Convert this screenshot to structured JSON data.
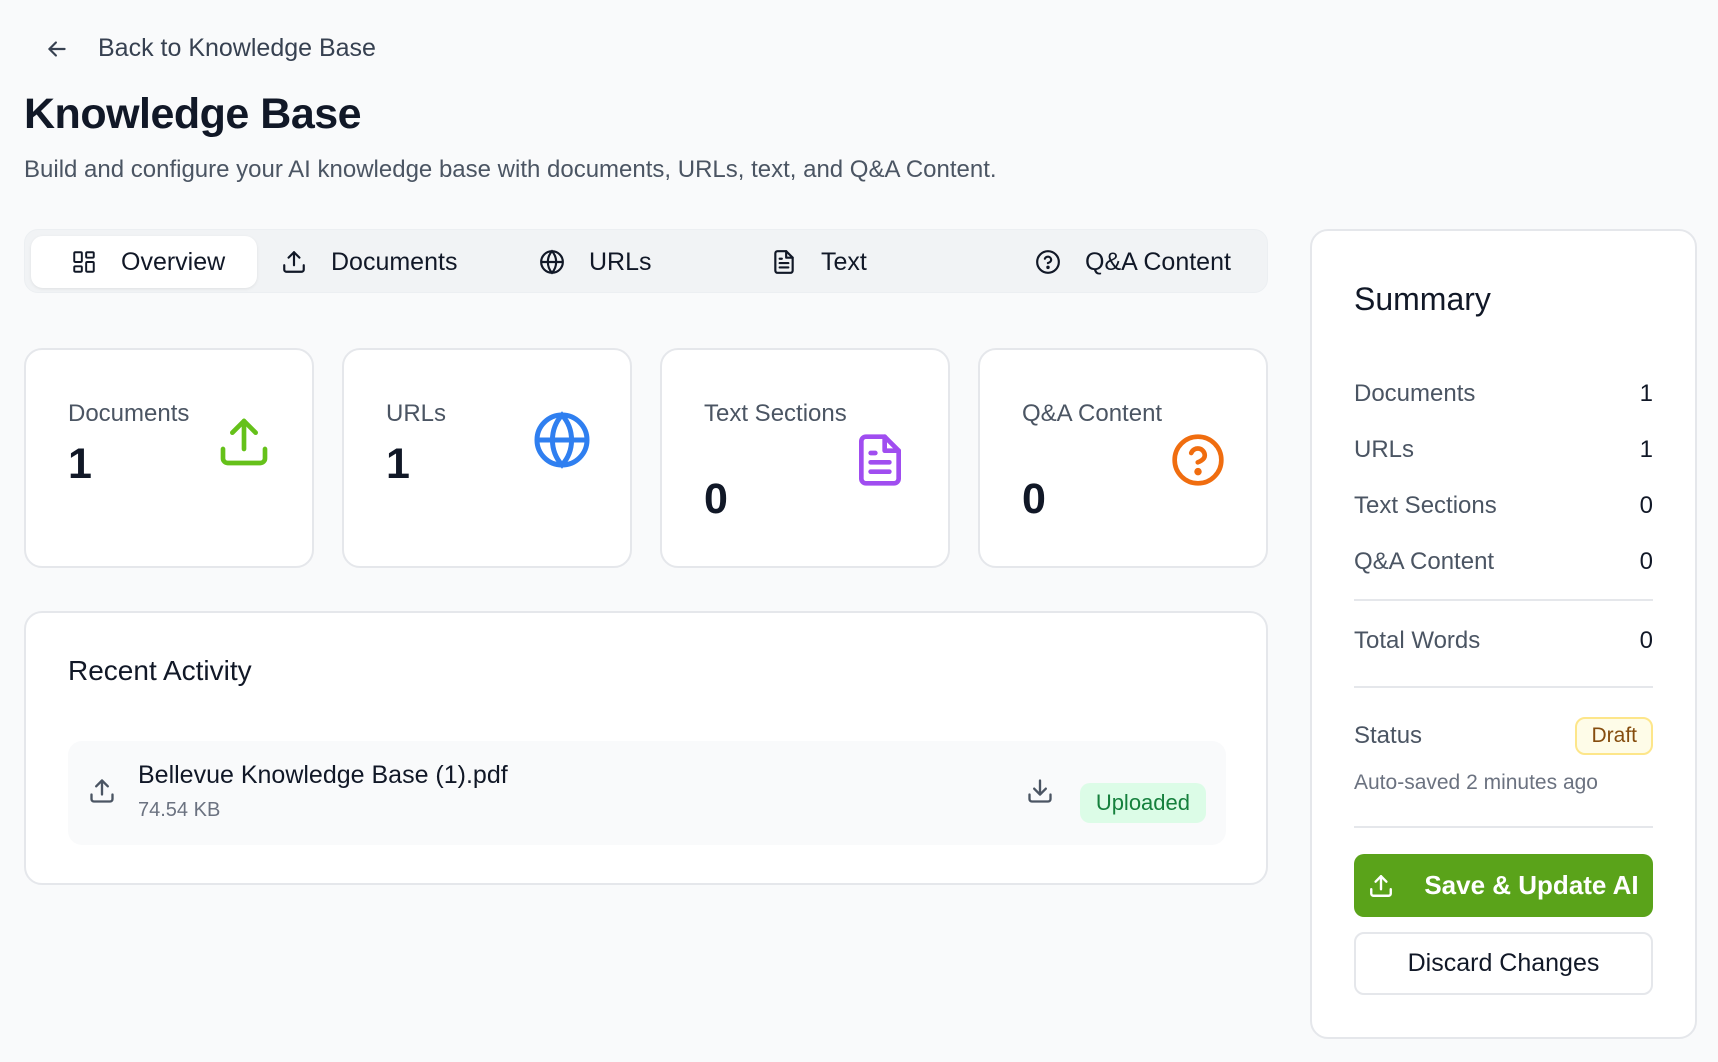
{
  "nav": {
    "back_label": "Back to Knowledge Base"
  },
  "header": {
    "title": "Knowledge Base",
    "subtitle": "Build and configure your AI knowledge base with documents, URLs, text, and Q&A Content."
  },
  "tabs": [
    {
      "label": "Overview",
      "icon": "grid-icon",
      "active": true
    },
    {
      "label": "Documents",
      "icon": "upload-icon"
    },
    {
      "label": "URLs",
      "icon": "globe-icon"
    },
    {
      "label": "Text",
      "icon": "document-icon"
    },
    {
      "label": "Q&A Content",
      "icon": "question-circle-icon"
    }
  ],
  "stats": [
    {
      "label": "Documents",
      "value": "1",
      "icon": "upload-icon",
      "color": "#65c11a"
    },
    {
      "label": "URLs",
      "value": "1",
      "icon": "globe-icon",
      "color": "#2f7ff0"
    },
    {
      "label": "Text Sections",
      "value": "0",
      "icon": "document-icon",
      "color": "#a04df0"
    },
    {
      "label": "Q&A Content",
      "value": "0",
      "icon": "question-circle-icon",
      "color": "#f06d0f"
    }
  ],
  "activity": {
    "title": "Recent Activity",
    "items": [
      {
        "name": "Bellevue Knowledge Base (1).pdf",
        "size": "74.54 KB",
        "status": "Uploaded"
      }
    ]
  },
  "summary": {
    "title": "Summary",
    "rows": [
      {
        "label": "Documents",
        "value": "1"
      },
      {
        "label": "URLs",
        "value": "1"
      },
      {
        "label": "Text Sections",
        "value": "0"
      },
      {
        "label": "Q&A Content",
        "value": "0"
      }
    ],
    "total_words": {
      "label": "Total Words",
      "value": "0"
    },
    "status": {
      "label": "Status",
      "badge": "Draft"
    },
    "autosave": "Auto-saved 2 minutes ago",
    "save_label": "Save & Update AI",
    "discard_label": "Discard Changes"
  },
  "colors": {
    "primary_green": "#5aa31a",
    "draft_badge_bg": "#fefce8",
    "uploaded_badge_bg": "#dcfce7"
  }
}
